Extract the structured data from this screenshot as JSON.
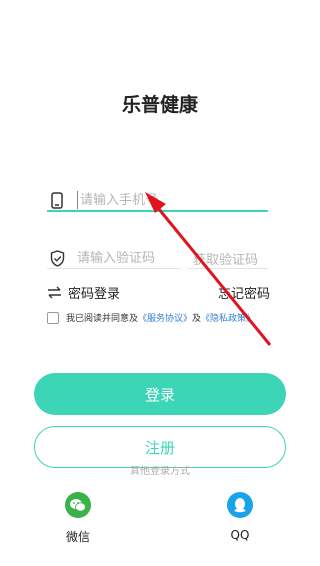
{
  "header": {
    "app_title": "乐普健康"
  },
  "phone": {
    "placeholder": "请输入手机号"
  },
  "code": {
    "placeholder": "请输入验证码",
    "get_code_label": "获取验证码"
  },
  "options": {
    "password_login": "密码登录",
    "forgot_password": "忘记密码"
  },
  "agreement": {
    "prefix": "我已阅读并同意及",
    "service_link": "《服务协议》",
    "and": "及",
    "privacy_link": "《隐私政策》"
  },
  "buttons": {
    "login": "登录",
    "register": "注册"
  },
  "other_login": {
    "title": "其他登录方式",
    "items": [
      {
        "label": "微信",
        "icon": "wechat-icon"
      },
      {
        "label": "QQ",
        "icon": "qq-icon"
      }
    ]
  },
  "colors": {
    "accent": "#3cd6b7",
    "link": "#2f7fd9",
    "annotation": "#e0141e"
  }
}
